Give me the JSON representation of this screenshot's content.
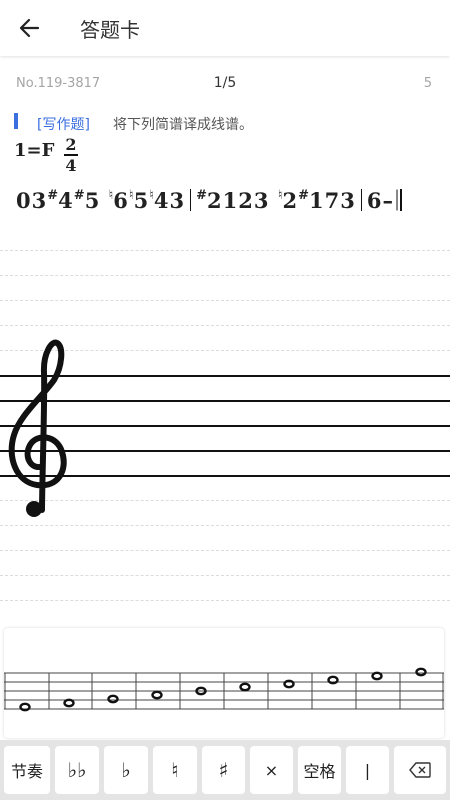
{
  "header": {
    "title": "答题卡"
  },
  "meta": {
    "id": "No.119-3817",
    "progress": "1/5",
    "total": "5"
  },
  "question": {
    "type": "[写作题]",
    "prompt": "将下列简谱译成线谱。",
    "key": "1=F",
    "time_num": "2",
    "time_den": "4",
    "measures": [
      [
        [
          "",
          "0"
        ],
        [
          "",
          "3"
        ],
        [
          "#",
          "4"
        ],
        [
          "#",
          "5"
        ],
        [
          "",
          "  "
        ],
        [
          "♮",
          "6"
        ],
        [
          "♮",
          "5"
        ],
        [
          "♮",
          "4"
        ],
        [
          "",
          "3"
        ]
      ],
      [
        [
          "#",
          "2"
        ],
        [
          "",
          "1"
        ],
        [
          "",
          "2"
        ],
        [
          "",
          "3"
        ],
        [
          "",
          "  "
        ],
        [
          "♮",
          "2"
        ],
        [
          "#",
          "1"
        ],
        [
          "",
          "7"
        ],
        [
          "",
          "3"
        ]
      ],
      [
        [
          "",
          "6"
        ],
        [
          "",
          "–"
        ]
      ]
    ]
  },
  "staff": {
    "clef": "treble-clef-icon"
  },
  "palette": {
    "note_count": 9,
    "notes": "scale of note heads"
  },
  "keyboard": {
    "rhythm": "节奏",
    "double_flat": "♭♭",
    "flat": "♭",
    "natural": "♮",
    "sharp": "♯",
    "cross": "×",
    "space": "空格",
    "barline": "|"
  }
}
